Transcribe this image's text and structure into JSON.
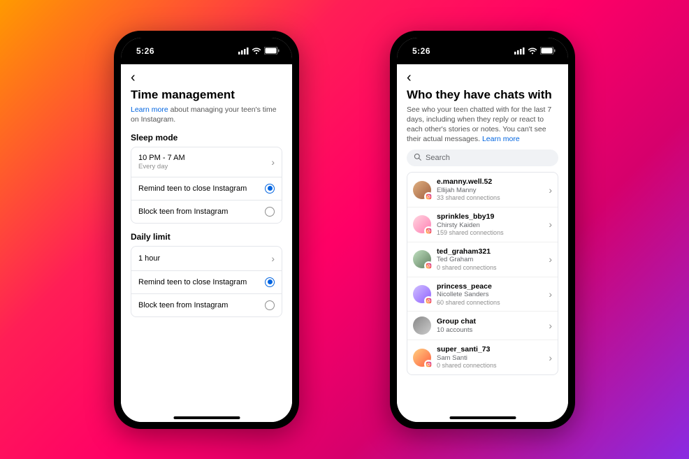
{
  "statusbar": {
    "time": "5:26"
  },
  "phone1": {
    "title": "Time management",
    "learn_more": "Learn more",
    "sub_after": " about managing your teen's time on Instagram.",
    "sleep": {
      "label": "Sleep mode",
      "window": "10 PM - 7 AM",
      "freq": "Every day",
      "opt_remind": "Remind teen to close Instagram",
      "opt_block": "Block teen from Instagram"
    },
    "daily": {
      "label": "Daily limit",
      "value": "1 hour",
      "opt_remind": "Remind teen to close Instagram",
      "opt_block": "Block teen from Instagram"
    }
  },
  "phone2": {
    "title": "Who they have chats with",
    "sub_before": "See who your teen chatted with for the last 7 days, including when they reply or react to each other's stories or notes. You can't see their actual messages. ",
    "learn_more": "Learn more",
    "search_placeholder": "Search",
    "chats": [
      {
        "username": "e.manny.well.52",
        "realname": "Ellijah Manny",
        "shared": "33 shared connections",
        "badge": true
      },
      {
        "username": "sprinkles_bby19",
        "realname": "Chirsty Kaiden",
        "shared": "159 shared connections",
        "badge": true
      },
      {
        "username": "ted_graham321",
        "realname": "Ted Graham",
        "shared": "0 shared connections",
        "badge": true
      },
      {
        "username": "princess_peace",
        "realname": "Nicollete Sanders",
        "shared": "60 shared connections",
        "badge": true
      },
      {
        "username": "Group chat",
        "realname": "10 accounts",
        "shared": "",
        "badge": false
      },
      {
        "username": "super_santi_73",
        "realname": "Sam Santi",
        "shared": "0 shared connections",
        "badge": true
      }
    ]
  }
}
